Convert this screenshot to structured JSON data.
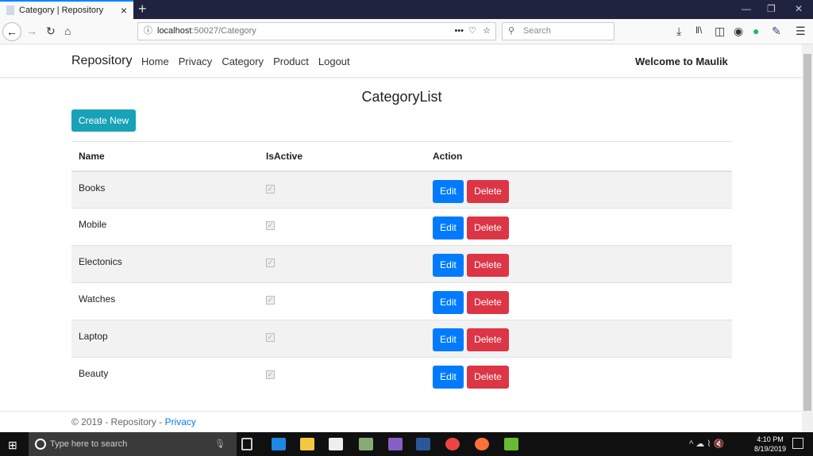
{
  "browser": {
    "tab_title": "Category | Repository",
    "url_host": "localhost",
    "url_rest": ":50027/Category",
    "search_placeholder": "Search"
  },
  "navbar": {
    "brand": "Repository",
    "links": [
      "Home",
      "Privacy",
      "Category",
      "Product",
      "Logout"
    ],
    "welcome": "Welcome to Maulik"
  },
  "page": {
    "title": "CategoryList",
    "create_label": "Create New"
  },
  "table": {
    "headers": [
      "Name",
      "IsActive",
      "Action"
    ],
    "rows": [
      {
        "name": "Books",
        "active": true
      },
      {
        "name": "Mobile",
        "active": true
      },
      {
        "name": "Electonics",
        "active": true
      },
      {
        "name": "Watches",
        "active": true
      },
      {
        "name": "Laptop",
        "active": true
      },
      {
        "name": "Beauty",
        "active": true
      }
    ],
    "edit_label": "Edit",
    "delete_label": "Delete"
  },
  "footer": {
    "text": "© 2019 - Repository - ",
    "link": "Privacy"
  },
  "taskbar": {
    "search_placeholder": "Type here to search",
    "time": "4:10 PM",
    "date": "8/19/2019"
  }
}
